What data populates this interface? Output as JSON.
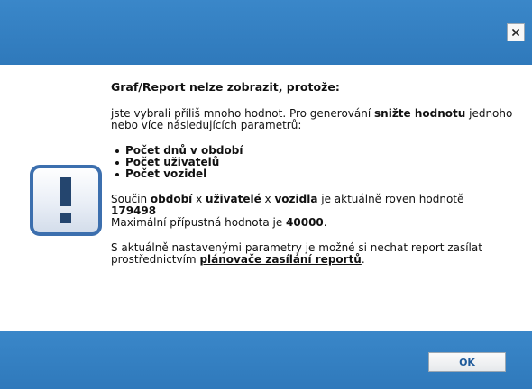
{
  "dialog": {
    "close_label": "x",
    "close_icon": "close-icon",
    "warning_icon": "exclamation-icon",
    "colors": {
      "header_bar": "#3580c3",
      "icon_blue": "#3c6fae",
      "ok_text": "#1e5a9a"
    }
  },
  "message": {
    "heading": "Graf/Report nelze zobrazit, protože:",
    "p1_start": "jste vybrali příliš mnoho hodnot. Pro generování ",
    "p1_bold": "snižte hodnotu",
    "p1_end": " jednoho nebo více následujících parametrů:",
    "parameters": [
      "Počet dnů v období",
      "Počet uživatelů",
      "Počet vozidel"
    ],
    "product_prefix": "Součin ",
    "product_term1": "období",
    "times1": " x ",
    "product_term2": "uživatelé",
    "times2": " x ",
    "product_term3": "vozidla",
    "product_suffix": " je aktuálně roven hodnotě",
    "product_value": "179498",
    "max_prefix": "Maximální přípustná hodnota je ",
    "max_value": "40000",
    "max_suffix": ".",
    "p3_start": "S aktuálně nastavenými parametry je možné si nechat report zasílat prostřednictvím ",
    "p3_link": "plánovače zasílání reportů",
    "p3_end": "."
  },
  "footer": {
    "ok_label": "OK"
  }
}
